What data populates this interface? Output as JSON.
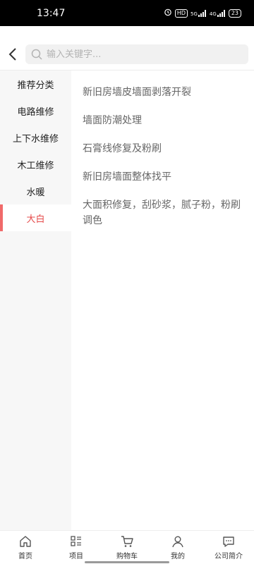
{
  "status": {
    "time": "13:47",
    "icons": [
      "alarm-icon",
      "hd-icon",
      "signal-5g-icon",
      "signal-4g-icon"
    ],
    "hd_label": "HD",
    "net1": "5G",
    "net2": "4G",
    "battery": "23"
  },
  "search": {
    "placeholder": "输入关键字..."
  },
  "sidebar": {
    "items": [
      {
        "label": "推荐分类"
      },
      {
        "label": "电路维修"
      },
      {
        "label": "上下水维修"
      },
      {
        "label": "木工维修"
      },
      {
        "label": "水暖"
      },
      {
        "label": "大白"
      }
    ],
    "active_index": 5
  },
  "content": {
    "items": [
      {
        "label": "新旧房墙皮墙面剥落开裂"
      },
      {
        "label": "墙面防潮处理"
      },
      {
        "label": "石膏线修复及粉刷"
      },
      {
        "label": "新旧房墙面整体找平"
      },
      {
        "label": "大面积修复，刮砂浆，腻子粉，粉刷调色"
      }
    ]
  },
  "tabbar": {
    "items": [
      {
        "label": "首页",
        "icon": "home-icon"
      },
      {
        "label": "项目",
        "icon": "grid-list-icon"
      },
      {
        "label": "购物车",
        "icon": "cart-icon"
      },
      {
        "label": "我的",
        "icon": "user-icon"
      },
      {
        "label": "公司简介",
        "icon": "chat-icon"
      }
    ]
  },
  "colors": {
    "accent": "#e64a4a",
    "sidebar_bg": "#f7f7f7"
  }
}
